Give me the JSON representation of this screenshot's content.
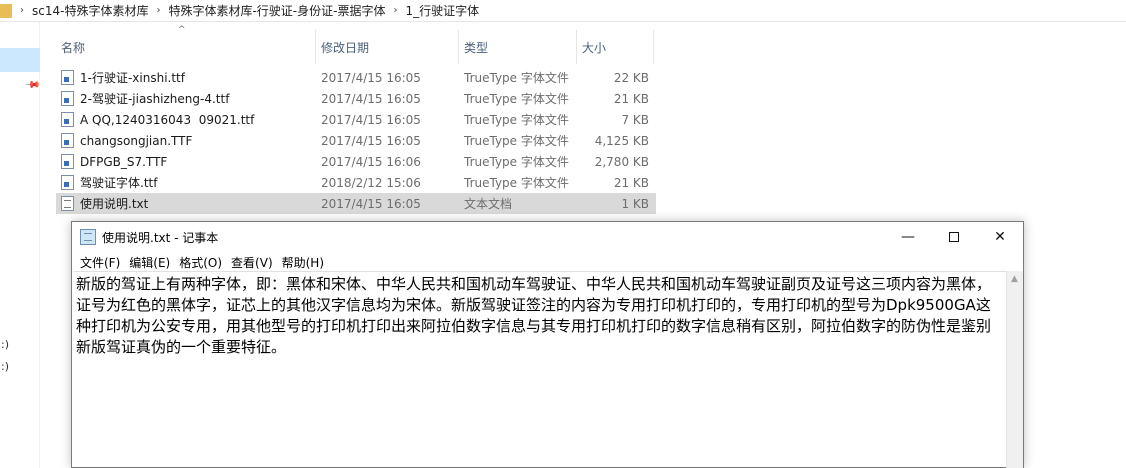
{
  "explorer": {
    "breadcrumb": [
      "sc14-特殊字体素材库",
      "特殊字体素材库-行驶证-身份证-票据字体",
      "1_行驶证字体"
    ],
    "side_labels": [
      ":)",
      ":)"
    ],
    "columns": {
      "name": "名称",
      "date": "修改日期",
      "type": "类型",
      "size": "大小"
    },
    "files": [
      {
        "name": "1-行驶证-xinshi.ttf",
        "date": "2017/4/15 16:05",
        "type": "TrueType 字体文件",
        "size": "22 KB",
        "icon": "font-file-icon"
      },
      {
        "name": "2-驾驶证-jiashizheng-4.ttf",
        "date": "2017/4/15 16:05",
        "type": "TrueType 字体文件",
        "size": "21 KB",
        "icon": "font-file-icon"
      },
      {
        "name": "A QQ,1240316043  09021.ttf",
        "date": "2017/4/15 16:05",
        "type": "TrueType 字体文件",
        "size": "7 KB",
        "icon": "font-file-icon"
      },
      {
        "name": "changsongjian.TTF",
        "date": "2017/4/15 16:05",
        "type": "TrueType 字体文件",
        "size": "4,125 KB",
        "icon": "font-file-icon"
      },
      {
        "name": "DFPGB_S7.TTF",
        "date": "2017/4/15 16:06",
        "type": "TrueType 字体文件",
        "size": "2,780 KB",
        "icon": "font-file-icon"
      },
      {
        "name": "驾驶证字体.ttf",
        "date": "2018/2/12 15:06",
        "type": "TrueType 字体文件",
        "size": "21 KB",
        "icon": "font-file-icon"
      },
      {
        "name": "使用说明.txt",
        "date": "2017/4/15 16:05",
        "type": "文本文档",
        "size": "1 KB",
        "icon": "text-file-icon",
        "selected": true
      }
    ]
  },
  "notepad": {
    "title": "使用说明.txt - 记事本",
    "menu": [
      "文件(F)",
      "编辑(E)",
      "格式(O)",
      "查看(V)",
      "帮助(H)"
    ],
    "controls": {
      "minimize": "—",
      "close": "✕"
    },
    "content": "新版的驾证上有两种字体，即：黑体和宋体、中华人民共和国机动车驾驶证、中华人民共和国机动车驾驶证副页及证号这三项内容为黑体，证号为红色的黑体字，证芯上的其他汉字信息均为宋体。新版驾驶证签注的内容为专用打印机打印的，专用打印机的型号为Dpk9500GA这种打印机为公安专用，用其他型号的打印机打印出来阿拉伯数字信息与其专用打印机打印的数字信息稍有区别，阿拉伯数字的防伪性是鉴别新版驾证真伪的一个重要特征。"
  },
  "colors": {
    "selection_blue": "#cce8ff",
    "row_selected_gray": "#d9d9d9",
    "header_text": "#4c607a",
    "folder_yellow": "#e9bd55"
  }
}
